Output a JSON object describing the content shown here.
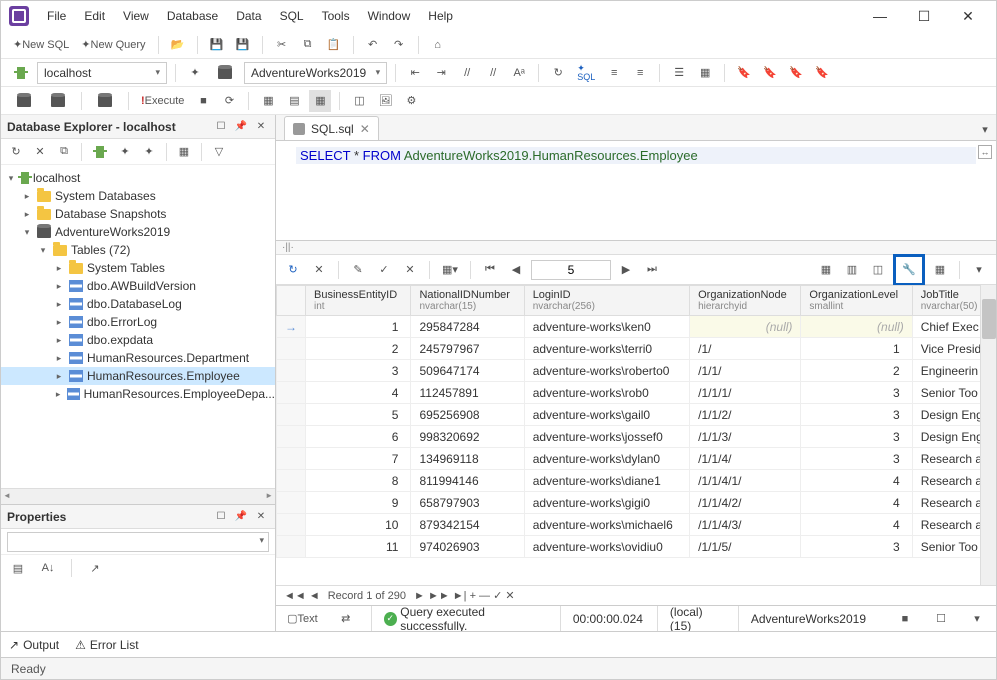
{
  "menubar": [
    "File",
    "Edit",
    "View",
    "Database",
    "Data",
    "SQL",
    "Tools",
    "Window",
    "Help"
  ],
  "toolbar1": {
    "new_sql": "New SQL",
    "new_query": "New Query"
  },
  "toolbar2": {
    "server": "localhost",
    "database": "AdventureWorks2019"
  },
  "toolbar3": {
    "execute": "Execute"
  },
  "explorer": {
    "title": "Database Explorer - localhost",
    "tree": {
      "server": "localhost",
      "sysdb": "System Databases",
      "snap": "Database Snapshots",
      "db": "AdventureWorks2019",
      "tables": "Tables (72)",
      "items": [
        "System Tables",
        "dbo.AWBuildVersion",
        "dbo.DatabaseLog",
        "dbo.ErrorLog",
        "dbo.expdata",
        "HumanResources.Department",
        "HumanResources.Employee",
        "HumanResources.EmployeeDepa..."
      ]
    }
  },
  "properties": {
    "title": "Properties"
  },
  "editor": {
    "tab": "SQL.sql",
    "sql_select": "SELECT",
    "sql_star": " * ",
    "sql_from": "FROM",
    "sql_ident": " AdventureWorks2019.HumanResources.Employee"
  },
  "grid_toolbar": {
    "page_input": "5"
  },
  "columns": [
    {
      "name": "BusinessEntityID",
      "type": "int"
    },
    {
      "name": "NationalIDNumber",
      "type": "nvarchar(15)"
    },
    {
      "name": "LoginID",
      "type": "nvarchar(256)"
    },
    {
      "name": "OrganizationNode",
      "type": "hierarchyid"
    },
    {
      "name": "OrganizationLevel",
      "type": "smallint"
    },
    {
      "name": "JobTitle",
      "type": "nvarchar(50)"
    }
  ],
  "rows": [
    {
      "id": "1",
      "nat": "295847284",
      "login": "adventure-works\\ken0",
      "org": "(null)",
      "lvl": "(null)",
      "job": "Chief Exec"
    },
    {
      "id": "2",
      "nat": "245797967",
      "login": "adventure-works\\terri0",
      "org": "/1/",
      "lvl": "1",
      "job": "Vice Presid"
    },
    {
      "id": "3",
      "nat": "509647174",
      "login": "adventure-works\\roberto0",
      "org": "/1/1/",
      "lvl": "2",
      "job": "Engineerin"
    },
    {
      "id": "4",
      "nat": "112457891",
      "login": "adventure-works\\rob0",
      "org": "/1/1/1/",
      "lvl": "3",
      "job": "Senior Too"
    },
    {
      "id": "5",
      "nat": "695256908",
      "login": "adventure-works\\gail0",
      "org": "/1/1/2/",
      "lvl": "3",
      "job": "Design Eng"
    },
    {
      "id": "6",
      "nat": "998320692",
      "login": "adventure-works\\jossef0",
      "org": "/1/1/3/",
      "lvl": "3",
      "job": "Design Eng"
    },
    {
      "id": "7",
      "nat": "134969118",
      "login": "adventure-works\\dylan0",
      "org": "/1/1/4/",
      "lvl": "3",
      "job": "Research a"
    },
    {
      "id": "8",
      "nat": "811994146",
      "login": "adventure-works\\diane1",
      "org": "/1/1/4/1/",
      "lvl": "4",
      "job": "Research a"
    },
    {
      "id": "9",
      "nat": "658797903",
      "login": "adventure-works\\gigi0",
      "org": "/1/1/4/2/",
      "lvl": "4",
      "job": "Research a"
    },
    {
      "id": "10",
      "nat": "879342154",
      "login": "adventure-works\\michael6",
      "org": "/1/1/4/3/",
      "lvl": "4",
      "job": "Research a"
    },
    {
      "id": "11",
      "nat": "974026903",
      "login": "adventure-works\\ovidiu0",
      "org": "/1/1/5/",
      "lvl": "3",
      "job": "Senior Too"
    }
  ],
  "grid_nav": {
    "record": "Record 1 of 290"
  },
  "status1": {
    "text": "Text",
    "msg": "Query executed successfully.",
    "time": "00:00:00.024",
    "conn": "(local) (15)",
    "db": "AdventureWorks2019"
  },
  "bottom_tabs": {
    "output": "Output",
    "errors": "Error List"
  },
  "statusbar": {
    "ready": "Ready"
  }
}
